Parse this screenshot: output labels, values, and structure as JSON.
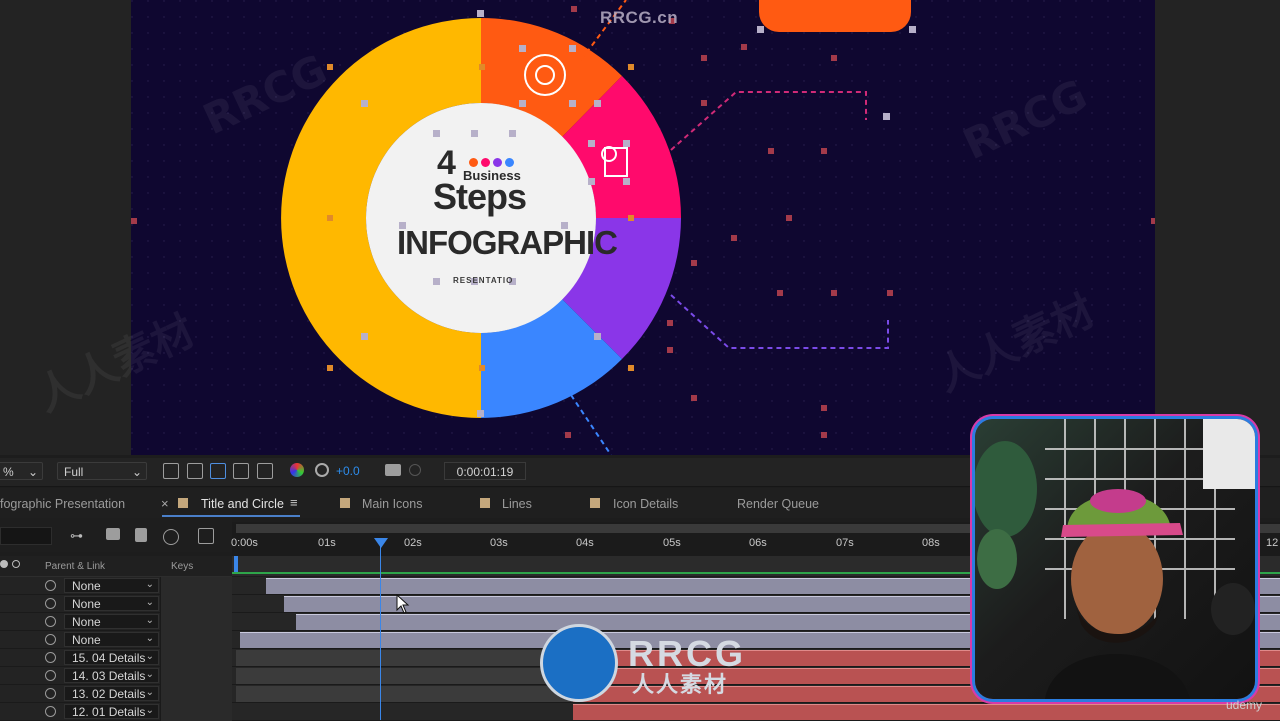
{
  "colors": {
    "accent": "#2d8ceb",
    "comp_bg": "#0f0730",
    "seg_yellow": "#ffb800",
    "seg_orange": "#ff5a12",
    "seg_pink": "#ff0a6c",
    "seg_purple": "#8a36e8",
    "seg_blue": "#3a86ff",
    "clip_red": "#b95252",
    "clip_gray": "#8d8da3"
  },
  "watermark": {
    "top_text": "RRCG.cn",
    "repeat_text": "RRCG",
    "cn_text": "人人素材"
  },
  "infographic": {
    "number": "4",
    "word_business": "Business",
    "word_steps": "Steps",
    "word_infographic": "INFOGRAPHIC",
    "word_presentation": "RESENTATIO"
  },
  "viewer_toolbar": {
    "zoom": "%",
    "resolution": "Full",
    "exposure": "+0.0",
    "timecode": "0:00:01:19"
  },
  "tabs": [
    {
      "label": "fographic Presentation",
      "active": false
    },
    {
      "label": "Title and Circle",
      "active": true
    },
    {
      "label": "Main Icons",
      "active": false
    },
    {
      "label": "Lines",
      "active": false
    },
    {
      "label": "Icon Details",
      "active": false
    },
    {
      "label": "Render Queue",
      "active": false
    }
  ],
  "timeline": {
    "col_parent": "Parent & Link",
    "col_keys": "Keys",
    "ticks": [
      "0:00s",
      "01s",
      "02s",
      "03s",
      "04s",
      "05s",
      "06s",
      "07s",
      "08s",
      "12"
    ],
    "current_time": "0:00:01:19",
    "layers": [
      {
        "parent": "None",
        "bar": "gray",
        "start_s": 0.35,
        "end_s": "10+"
      },
      {
        "parent": "None",
        "bar": "gray",
        "start_s": 0.55,
        "end_s": "10+"
      },
      {
        "parent": "None",
        "bar": "gray",
        "start_s": 0.7,
        "end_s": "10+"
      },
      {
        "parent": "None",
        "bar": "gray",
        "start_s": 0.05,
        "end_s": "10+"
      },
      {
        "parent": "15. 04 Details",
        "bar": "red",
        "start_s": "",
        "end_s": "10+"
      },
      {
        "parent": "14. 03 Details",
        "bar": "red",
        "start_s": "",
        "end_s": "10+"
      },
      {
        "parent": "13. 02 Details",
        "bar": "red",
        "start_s": "",
        "end_s": "10+"
      },
      {
        "parent": "12. 01 Details",
        "bar": "red",
        "start_s": 3.9,
        "end_s": "10+"
      }
    ]
  },
  "logo": {
    "main": "RRCG",
    "sub": "人人素材"
  },
  "webcam_label": "udemy"
}
